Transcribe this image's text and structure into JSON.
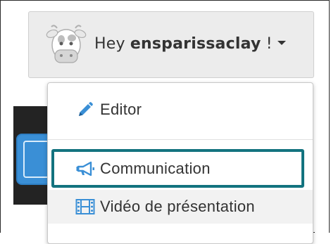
{
  "user_menu": {
    "greeting_prefix": "Hey ",
    "username": "ensparissaclay",
    "greeting_suffix": " !",
    "avatar_icon": "cow-avatar-icon"
  },
  "dropdown": {
    "items": [
      {
        "label": "Editor",
        "icon": "pencil-icon"
      },
      {
        "label": "Communication",
        "icon": "megaphone-icon"
      },
      {
        "label": "Vidéo de présentation",
        "icon": "film-icon"
      }
    ]
  },
  "colors": {
    "highlight": "#13737f",
    "icon_blue": "#3a8fd6",
    "text": "#333333"
  }
}
